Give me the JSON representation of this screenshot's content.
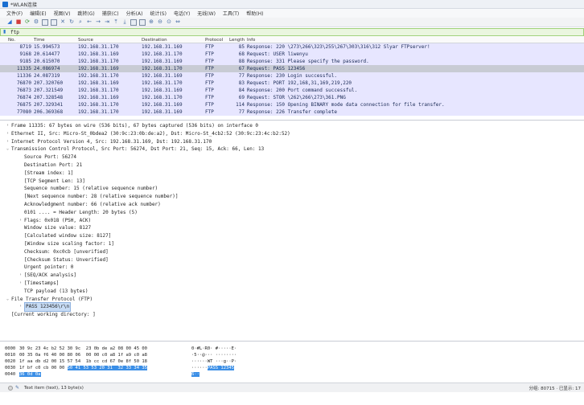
{
  "window": {
    "title": "*WLAN连接"
  },
  "menu": [
    "文件(F)",
    "编辑(E)",
    "视图(V)",
    "跳转(G)",
    "捕获(C)",
    "分析(A)",
    "统计(S)",
    "电话(Y)",
    "无线(W)",
    "工具(T)",
    "帮助(H)"
  ],
  "filter": {
    "value": "ftp"
  },
  "columns": {
    "no": "No.",
    "time": "Time",
    "src": "Source",
    "dst": "Destination",
    "proto": "Protocol",
    "len": "Length",
    "info": "Info"
  },
  "packets": [
    {
      "no": "8719",
      "time": "15.994573",
      "src": "192.168.31.170",
      "dst": "192.168.31.169",
      "proto": "FTP",
      "len": "85",
      "info": "Response: 220 \\273\\266\\323\\255\\267\\303\\316\\312 Slyar FTPserver!",
      "style": "ftp"
    },
    {
      "no": "9168",
      "time": "20.614477",
      "src": "192.168.31.169",
      "dst": "192.168.31.170",
      "proto": "FTP",
      "len": "68",
      "info": "Request: USER liwenyu",
      "style": "ftp"
    },
    {
      "no": "9185",
      "time": "20.615070",
      "src": "192.168.31.170",
      "dst": "192.168.31.169",
      "proto": "FTP",
      "len": "88",
      "info": "Response: 331 Please specify the password.",
      "style": "ftp"
    },
    {
      "no": "11335",
      "time": "24.086974",
      "src": "192.168.31.169",
      "dst": "192.168.31.170",
      "proto": "FTP",
      "len": "67",
      "info": "Request: PASS 123456",
      "style": "sel"
    },
    {
      "no": "11336",
      "time": "24.087319",
      "src": "192.168.31.170",
      "dst": "192.168.31.169",
      "proto": "FTP",
      "len": "77",
      "info": "Response: 230 Login successful.",
      "style": "ftp"
    },
    {
      "no": "76870",
      "time": "207.320760",
      "src": "192.168.31.169",
      "dst": "192.168.31.170",
      "proto": "FTP",
      "len": "83",
      "info": "Request: PORT 192,168,31,169,219,220",
      "style": "ftp"
    },
    {
      "no": "76873",
      "time": "207.321549",
      "src": "192.168.31.170",
      "dst": "192.168.31.169",
      "proto": "FTP",
      "len": "84",
      "info": "Response: 200 Port command successful.",
      "style": "ftp"
    },
    {
      "no": "76874",
      "time": "207.328548",
      "src": "192.168.31.169",
      "dst": "192.168.31.170",
      "proto": "FTP",
      "len": "69",
      "info": "Request: STOR \\262\\266\\273\\361.PNG",
      "style": "ftp"
    },
    {
      "no": "76875",
      "time": "207.329341",
      "src": "192.168.31.170",
      "dst": "192.168.31.169",
      "proto": "FTP",
      "len": "114",
      "info": "Response: 150 Opening BINARY mode data connection for file transfer.",
      "style": "ftp"
    },
    {
      "no": "77080",
      "time": "206.369368",
      "src": "192.168.31.170",
      "dst": "192.168.31.169",
      "proto": "FTP",
      "len": "77",
      "info": "Response: 226 Transfer complete",
      "style": "ftp"
    }
  ],
  "details": [
    {
      "text": "Frame 11335: 67 bytes on wire (536 bits), 67 bytes captured (536 bits) on interface 0",
      "level": "top",
      "arrow": "›"
    },
    {
      "text": "Ethernet II, Src: Micro-St_0bdea2 (30:9c:23:0b:de:a2), Dst: Micro-St_4cb2:52 (30:9c:23:4c:b2:52)",
      "level": "top",
      "arrow": "›"
    },
    {
      "text": "Internet Protocol Version 4, Src: 192.168.31.169, Dst: 192.168.31.170",
      "level": "top",
      "arrow": "›"
    },
    {
      "text": "Transmission Control Protocol, Src Port: 56274, Dst Port: 21, Seq: 15, Ack: 66, Len: 13",
      "level": "top",
      "arrow": "⌄"
    },
    {
      "text": "Source Port: 56274",
      "level": "ind1",
      "arrow": ""
    },
    {
      "text": "Destination Port: 21",
      "level": "ind1",
      "arrow": ""
    },
    {
      "text": "[Stream index: 1]",
      "level": "ind1",
      "arrow": ""
    },
    {
      "text": "[TCP Segment Len: 13]",
      "level": "ind1",
      "arrow": ""
    },
    {
      "text": "Sequence number: 15    (relative sequence number)",
      "level": "ind1",
      "arrow": ""
    },
    {
      "text": "[Next sequence number: 28    (relative sequence number)]",
      "level": "ind1",
      "arrow": ""
    },
    {
      "text": "Acknowledgment number: 66    (relative ack number)",
      "level": "ind1",
      "arrow": ""
    },
    {
      "text": "0101 .... = Header Length: 20 bytes (5)",
      "level": "ind1",
      "arrow": ""
    },
    {
      "text": "Flags: 0x018 (PSH, ACK)",
      "level": "ind2",
      "arrow": "›"
    },
    {
      "text": "Window size value: 8127",
      "level": "ind1",
      "arrow": ""
    },
    {
      "text": "[Calculated window size: 8127]",
      "level": "ind1",
      "arrow": ""
    },
    {
      "text": "[Window size scaling factor: 1]",
      "level": "ind1",
      "arrow": ""
    },
    {
      "text": "Checksum: 0xc0cb [unverified]",
      "level": "ind1",
      "arrow": ""
    },
    {
      "text": "[Checksum Status: Unverified]",
      "level": "ind1",
      "arrow": ""
    },
    {
      "text": "Urgent pointer: 0",
      "level": "ind1",
      "arrow": ""
    },
    {
      "text": "[SEQ/ACK analysis]",
      "level": "ind2",
      "arrow": "›"
    },
    {
      "text": "[Timestamps]",
      "level": "ind2",
      "arrow": "›"
    },
    {
      "text": "TCP payload (13 bytes)",
      "level": "ind1",
      "arrow": ""
    },
    {
      "text": "File Transfer Protocol (FTP)",
      "level": "top",
      "arrow": "⌄"
    },
    {
      "text": "PASS 123456\\r\\n",
      "level": "ind2",
      "arrow": "›",
      "highlight": true
    },
    {
      "text": "[Current working directory: ]",
      "level": "top",
      "arrow": ""
    }
  ],
  "bytes": [
    {
      "off": "0000",
      "hex": "30 9c 23 4c b2 52 30 9c  23 0b de a2 08 00 45 00",
      "asc": "0·#L·R0· #·····E·",
      "hl_hex": "",
      "hl_asc": ""
    },
    {
      "off": "0010",
      "hex": "00 35 0a f6 40 00 80 06  00 00 c0 a8 1f a9 c0 a8",
      "asc": "·5··@··· ········",
      "hl_hex": "",
      "hl_asc": ""
    },
    {
      "off": "0020",
      "hex": "1f aa db d2 00 15 57 54  1b cc cd 67 0e 8f 50 18",
      "asc": "······WT ···g··P·",
      "hl_hex": "",
      "hl_asc": ""
    },
    {
      "off": "0030",
      "hex": "1f bf c0 cb 00 00 ",
      "asc": "······",
      "hl_hex": "50 41 53 53 20 31  32 33 34 35",
      "hl_asc": "PASS 12345"
    },
    {
      "off": "0040",
      "hex": "",
      "asc": "",
      "hl_hex": "36 0d 0a",
      "hl_asc": "6··"
    }
  ],
  "status": {
    "left": "Text item (text), 13 byte(s)",
    "right": "分组: 80715 · 已显示: 17"
  }
}
